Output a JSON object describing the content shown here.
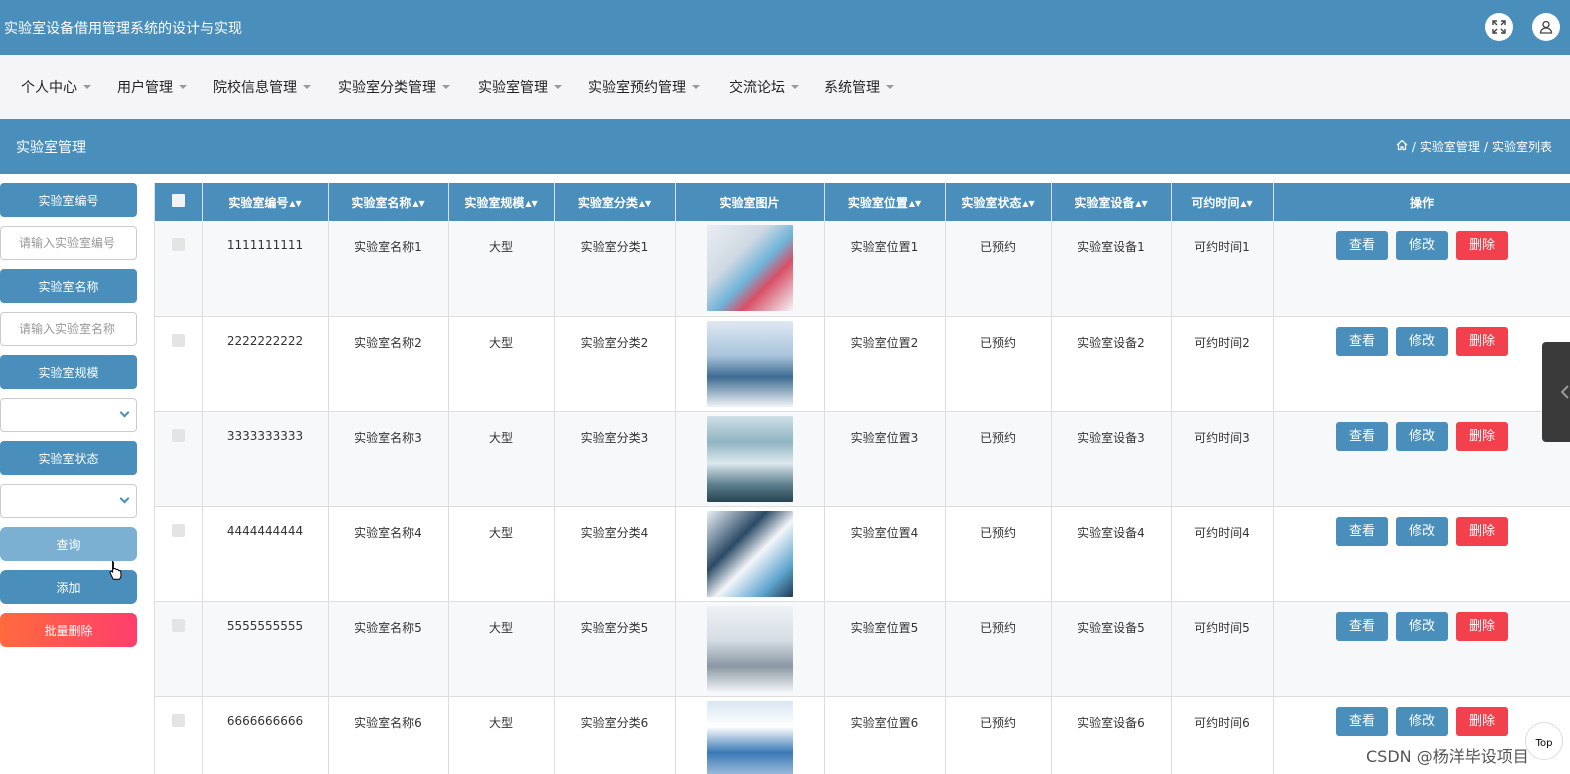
{
  "app": {
    "title": "实验室设备借用管理系统的设计与实现"
  },
  "nav": {
    "items": [
      {
        "label": "个人中心"
      },
      {
        "label": "用户管理"
      },
      {
        "label": "院校信息管理"
      },
      {
        "label": "实验室分类管理"
      },
      {
        "label": "实验室管理"
      },
      {
        "label": "实验室预约管理"
      },
      {
        "label": "交流论坛"
      },
      {
        "label": "系统管理"
      }
    ]
  },
  "section": {
    "title": "实验室管理",
    "breadcrumb": [
      "实验室管理",
      "实验室列表"
    ],
    "breadcrumb_sep": "/"
  },
  "search": {
    "lab_no_label": "实验室编号",
    "lab_no_placeholder": "请输入实验室编号",
    "lab_name_label": "实验室名称",
    "lab_name_placeholder": "请输入实验室名称",
    "scale_label": "实验室规模",
    "scale_value": "",
    "status_label": "实验室状态",
    "status_value": "",
    "query_button": "查询",
    "add_button": "添加",
    "batch_delete_button": "批量删除"
  },
  "table": {
    "columns": [
      "实验室编号",
      "实验室名称",
      "实验室规模",
      "实验室分类",
      "实验室图片",
      "实验室位置",
      "实验室状态",
      "实验室设备",
      "可约时间",
      "操作"
    ],
    "sortable": [
      true,
      true,
      true,
      true,
      false,
      true,
      true,
      true,
      true,
      false
    ],
    "actions": {
      "view": "查看",
      "edit": "修改",
      "delete": "删除"
    },
    "rows": [
      {
        "no": "1111111111",
        "name": "实验室名称1",
        "scale": "大型",
        "category": "实验室分类1",
        "location": "实验室位置1",
        "status": "已预约",
        "equipment": "实验室设备1",
        "time": "可约时间1"
      },
      {
        "no": "2222222222",
        "name": "实验室名称2",
        "scale": "大型",
        "category": "实验室分类2",
        "location": "实验室位置2",
        "status": "已预约",
        "equipment": "实验室设备2",
        "time": "可约时间2"
      },
      {
        "no": "3333333333",
        "name": "实验室名称3",
        "scale": "大型",
        "category": "实验室分类3",
        "location": "实验室位置3",
        "status": "已预约",
        "equipment": "实验室设备3",
        "time": "可约时间3"
      },
      {
        "no": "4444444444",
        "name": "实验室名称4",
        "scale": "大型",
        "category": "实验室分类4",
        "location": "实验室位置4",
        "status": "已预约",
        "equipment": "实验室设备4",
        "time": "可约时间4"
      },
      {
        "no": "5555555555",
        "name": "实验室名称5",
        "scale": "大型",
        "category": "实验室分类5",
        "location": "实验室位置5",
        "status": "已预约",
        "equipment": "实验室设备5",
        "time": "可约时间5"
      },
      {
        "no": "6666666666",
        "name": "实验室名称6",
        "scale": "大型",
        "category": "实验室分类6",
        "location": "实验室位置6",
        "status": "已预约",
        "equipment": "实验室设备6",
        "time": "可约时间6"
      }
    ]
  },
  "overlay": {
    "top_button": "Top",
    "watermark": "CSDN @杨洋毕设项目"
  },
  "colors": {
    "primary": "#4a8fbb",
    "danger": "#f2414c",
    "query_disabled": "#7cb0d3",
    "batch_delete_gradient": [
      "#ff6a3d",
      "#ff3e6c"
    ]
  }
}
